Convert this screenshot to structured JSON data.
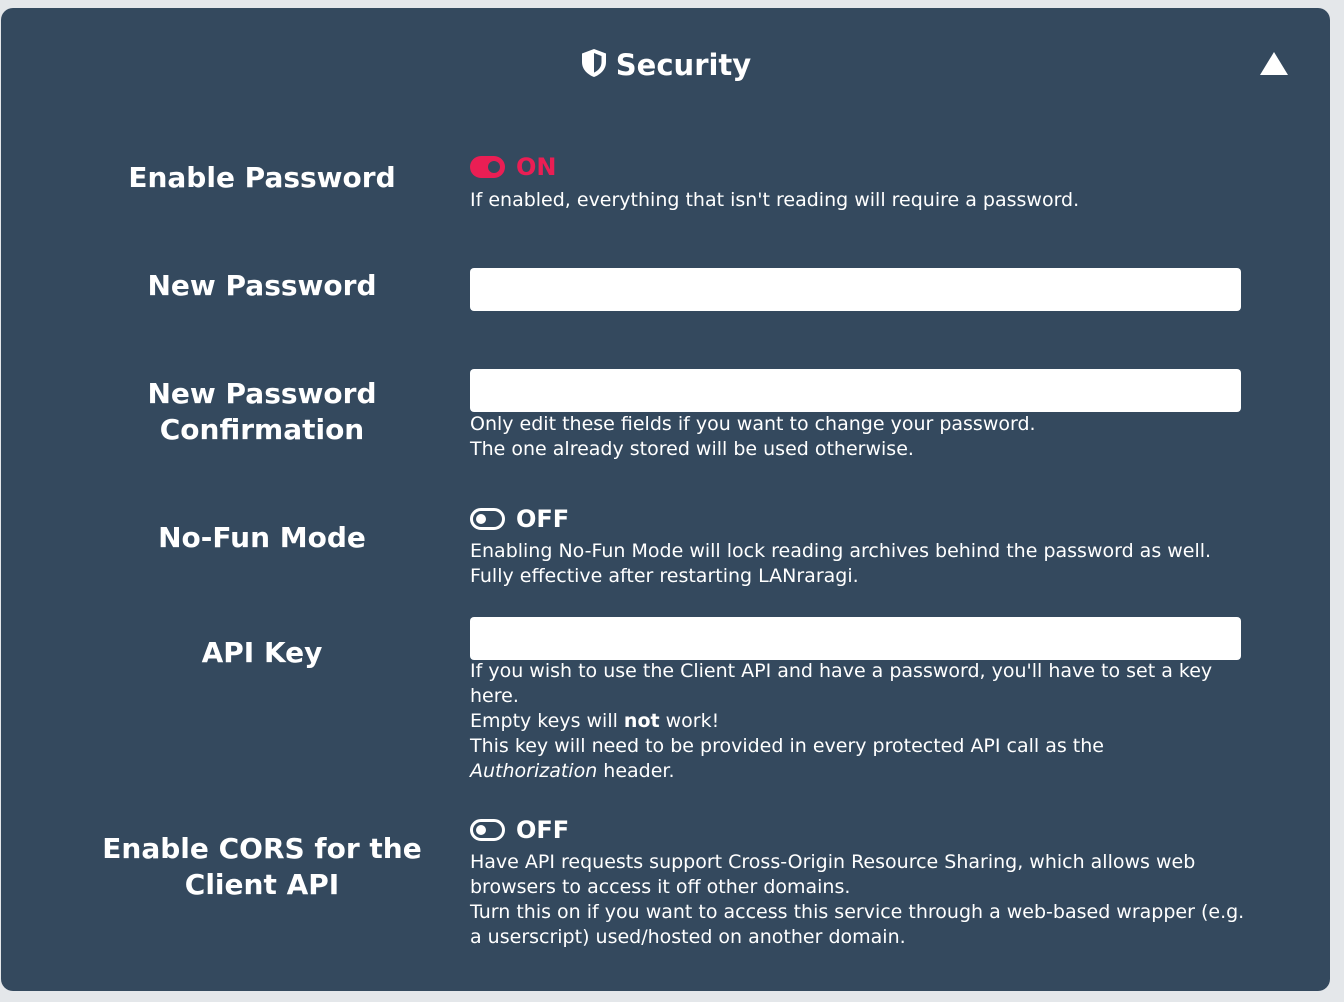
{
  "colors": {
    "panel_bg": "#34495e",
    "page_bg": "#e4e7ea",
    "accent_on": "#ea1e54",
    "text": "#ffffff",
    "input_bg": "#ffffff"
  },
  "section": {
    "title": "Security",
    "title_icon": "shield-icon",
    "collapse_icon": "triangle-up-icon"
  },
  "enable_password": {
    "label": "Enable Password",
    "state": "ON",
    "help": "If enabled, everything that isn't reading will require a password."
  },
  "new_password": {
    "label": "New Password",
    "value": "",
    "placeholder": ""
  },
  "new_password_confirmation": {
    "label": "New Password\nConfirmation",
    "value": "",
    "placeholder": "",
    "help_line1": "Only edit these fields if you want to change your password.",
    "help_line2": "The one already stored will be used otherwise."
  },
  "no_fun_mode": {
    "label": "No-Fun Mode",
    "state": "OFF",
    "help_line1": "Enabling No-Fun Mode will lock reading archives behind the password as well.",
    "help_line2": "Fully effective after restarting LANraragi."
  },
  "api_key": {
    "label": "API Key",
    "value": "",
    "placeholder": "",
    "help_line1": "If you wish to use the Client API and have a password, you'll have to set a key here.",
    "help_line2_before": "Empty keys will ",
    "help_line2_bold": "not",
    "help_line2_after": " work!",
    "help_line3": "This key will need to be provided in every protected API call as the",
    "help_line4_italic": "Authorization",
    "help_line4_after": " header."
  },
  "enable_cors": {
    "label": "Enable CORS for the\nClient API",
    "state": "OFF",
    "help_line1": "Have API requests support Cross-Origin Resource Sharing, which allows web browsers to access it off other domains.",
    "help_line2": "Turn this on if you want to access this service through a web-based wrapper (e.g. a userscript) used/hosted on another domain."
  }
}
